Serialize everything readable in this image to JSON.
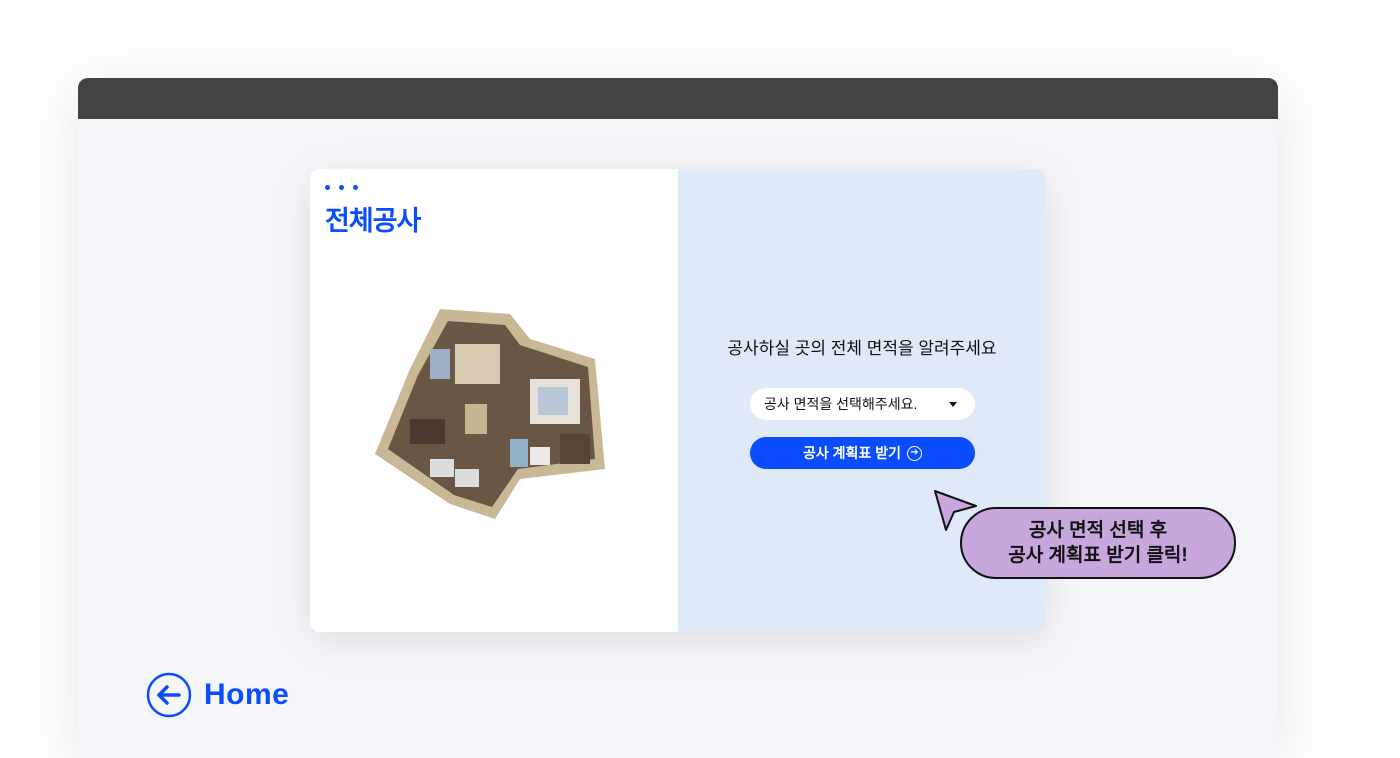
{
  "card": {
    "title": "전체공사",
    "prompt": "공사하실 곳의 전체 면적을 알려주세요",
    "area_select": {
      "value": "공사 면적을 선택해주세요."
    },
    "submit_button": {
      "label": "공사 계획표 받기",
      "icon": "arrow-circle-right"
    }
  },
  "hint": {
    "line1": "공사 면적 선택 후",
    "line2": "공사 계획표 받기 클릭!"
  },
  "nav": {
    "home_label": "Home",
    "home_icon": "arrow-left-circle"
  },
  "colors": {
    "accent": "#0a4cff",
    "panel": "#e0e9f8",
    "bubble": "#c8a7de",
    "titlebar": "#434343"
  }
}
